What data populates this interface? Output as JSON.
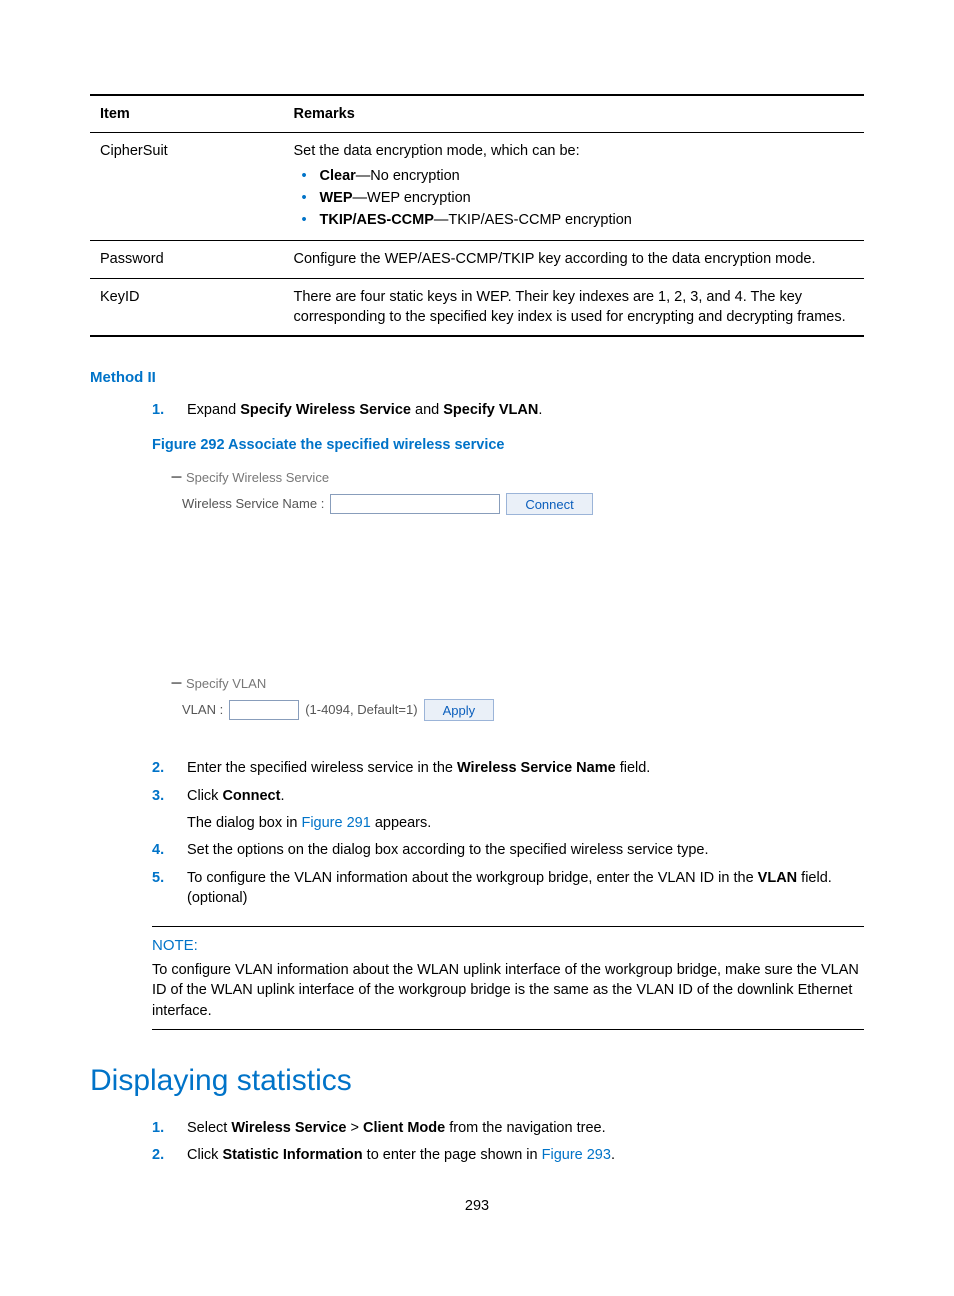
{
  "table": {
    "headers": {
      "item": "Item",
      "remarks": "Remarks"
    },
    "rows": [
      {
        "item": "CipherSuit",
        "intro": "Set the data encryption mode, which can be:",
        "options": [
          {
            "b": "Clear",
            "t": "—No encryption"
          },
          {
            "b": "WEP",
            "t": "—WEP encryption"
          },
          {
            "b": "TKIP/AES-CCMP",
            "t": "—TKIP/AES-CCMP encryption"
          }
        ]
      },
      {
        "item": "Password",
        "text": "Configure the WEP/AES-CCMP/TKIP key according to the data encryption mode."
      },
      {
        "item": "KeyID",
        "text": "There are four static keys in WEP. Their key indexes are 1, 2, 3, and 4. The key corresponding to the specified key index is used for encrypting and decrypting frames."
      }
    ]
  },
  "method2": {
    "title": "Method II",
    "step1_pre": "Expand ",
    "step1_b1": "Specify Wireless Service",
    "step1_mid": " and ",
    "step1_b2": "Specify VLAN",
    "step1_post": ".",
    "figure_caption": "Figure 292 Associate the specified wireless service",
    "panel1": {
      "header": "Specify Wireless Service",
      "label": "Wireless Service Name :",
      "button": "Connect"
    },
    "panel2": {
      "header": "Specify VLAN",
      "label": "VLAN :",
      "hint": "(1-4094, Default=1)",
      "button": "Apply"
    },
    "step2_pre": "Enter the specified wireless service in the ",
    "step2_b": "Wireless Service Name",
    "step2_post": " field.",
    "step3_pre": "Click ",
    "step3_b": "Connect",
    "step3_post": ".",
    "step3_sub_pre": "The dialog box in ",
    "step3_link": "Figure 291",
    "step3_sub_post": " appears.",
    "step4": "Set the options on the dialog box according to the specified wireless service type.",
    "step5_pre": "To configure the VLAN information about the workgroup bridge, enter the VLAN ID in the ",
    "step5_b": "VLAN",
    "step5_post": " field. (optional)"
  },
  "note": {
    "title": "NOTE:",
    "body": "To configure VLAN information about the WLAN uplink interface of the workgroup bridge, make sure the VLAN ID of the WLAN uplink interface of the workgroup bridge is the same as the VLAN ID of the downlink Ethernet interface."
  },
  "display_stats": {
    "heading": "Displaying statistics",
    "s1_pre": "Select ",
    "s1_b1": "Wireless Service",
    "s1_mid": " > ",
    "s1_b2": "Client Mode",
    "s1_post": " from the navigation tree.",
    "s2_pre": "Click ",
    "s2_b": "Statistic Information",
    "s2_mid": " to enter the page shown in ",
    "s2_link": "Figure 293",
    "s2_post": "."
  },
  "nums": {
    "n1": "1.",
    "n2": "2.",
    "n3": "3.",
    "n4": "4.",
    "n5": "5."
  },
  "page_number": "293"
}
